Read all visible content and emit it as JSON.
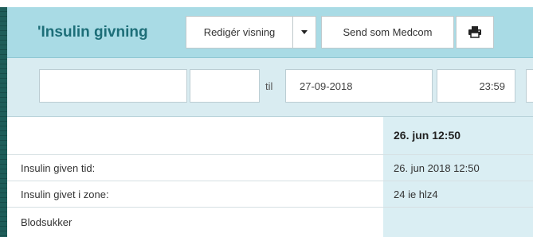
{
  "header": {
    "title": "'Insulin givning",
    "edit_view_label": "Redigér visning",
    "caret_icon": "caret-down-icon",
    "send_label": "Send som Medcom",
    "print_icon": "printer-icon"
  },
  "filters": {
    "from_date": "",
    "from_time": "",
    "separator": "til",
    "to_date": "27-09-2018",
    "to_time": "23:59"
  },
  "table": {
    "column_header": "26. jun 12:50",
    "rows": [
      {
        "label": "Insulin given tid:",
        "value": "26. jun 2018 12:50"
      },
      {
        "label": "Insulin givet i zone:",
        "value": "24 ie hlz4"
      },
      {
        "label": "Blodsukker",
        "value": ""
      }
    ]
  },
  "colors": {
    "header_bg": "#a9dbe5",
    "filter_bg": "#d9ecf1",
    "title_color": "#1d6e78",
    "column_shade": "#daeef3"
  }
}
